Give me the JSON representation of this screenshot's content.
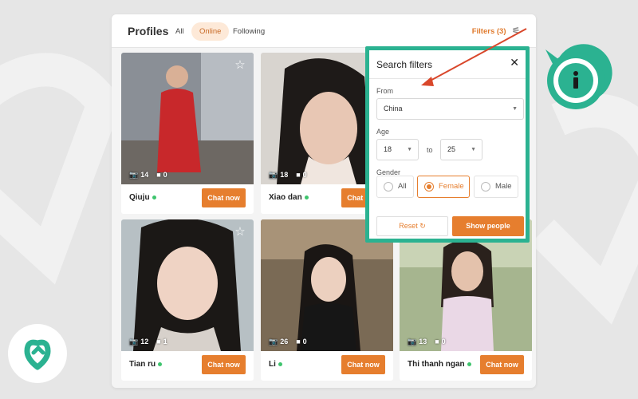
{
  "header": {
    "title": "Profiles",
    "tabs": [
      {
        "label": "All",
        "active": false
      },
      {
        "label": "Online",
        "active": true
      },
      {
        "label": "Following",
        "active": false
      }
    ],
    "filters_label": "Filters (3)",
    "filters_icon": "sliders-icon"
  },
  "profiles": [
    {
      "name": "Qiuju",
      "photos": "14",
      "videos": "0",
      "online": true,
      "chat_label": "Chat now",
      "favorite": true
    },
    {
      "name": "Xiao dan",
      "photos": "18",
      "videos": "0",
      "online": true,
      "chat_label": "Chat now",
      "favorite": false
    },
    {
      "name": "Tian ru",
      "photos": "12",
      "videos": "1",
      "online": true,
      "chat_label": "Chat now",
      "favorite": true
    },
    {
      "name": "Li",
      "photos": "26",
      "videos": "0",
      "online": true,
      "chat_label": "Chat now",
      "favorite": false
    },
    {
      "name": "Thi thanh ngan",
      "photos": "13",
      "videos": "0",
      "online": true,
      "chat_label": "Chat now",
      "favorite": false
    }
  ],
  "search_filters": {
    "title": "Search filters",
    "from_label": "From",
    "from_value": "China",
    "age_label": "Age",
    "age_min": "18",
    "age_to": "to",
    "age_max": "25",
    "gender_label": "Gender",
    "gender_options": [
      "All",
      "Female",
      "Male"
    ],
    "gender_selected": "Female",
    "reset_label": "Reset",
    "show_label": "Show people"
  },
  "colors": {
    "accent": "#e67e2e",
    "highlight": "#2bb291",
    "online": "#3ec46d",
    "arrow": "#d9472b"
  }
}
